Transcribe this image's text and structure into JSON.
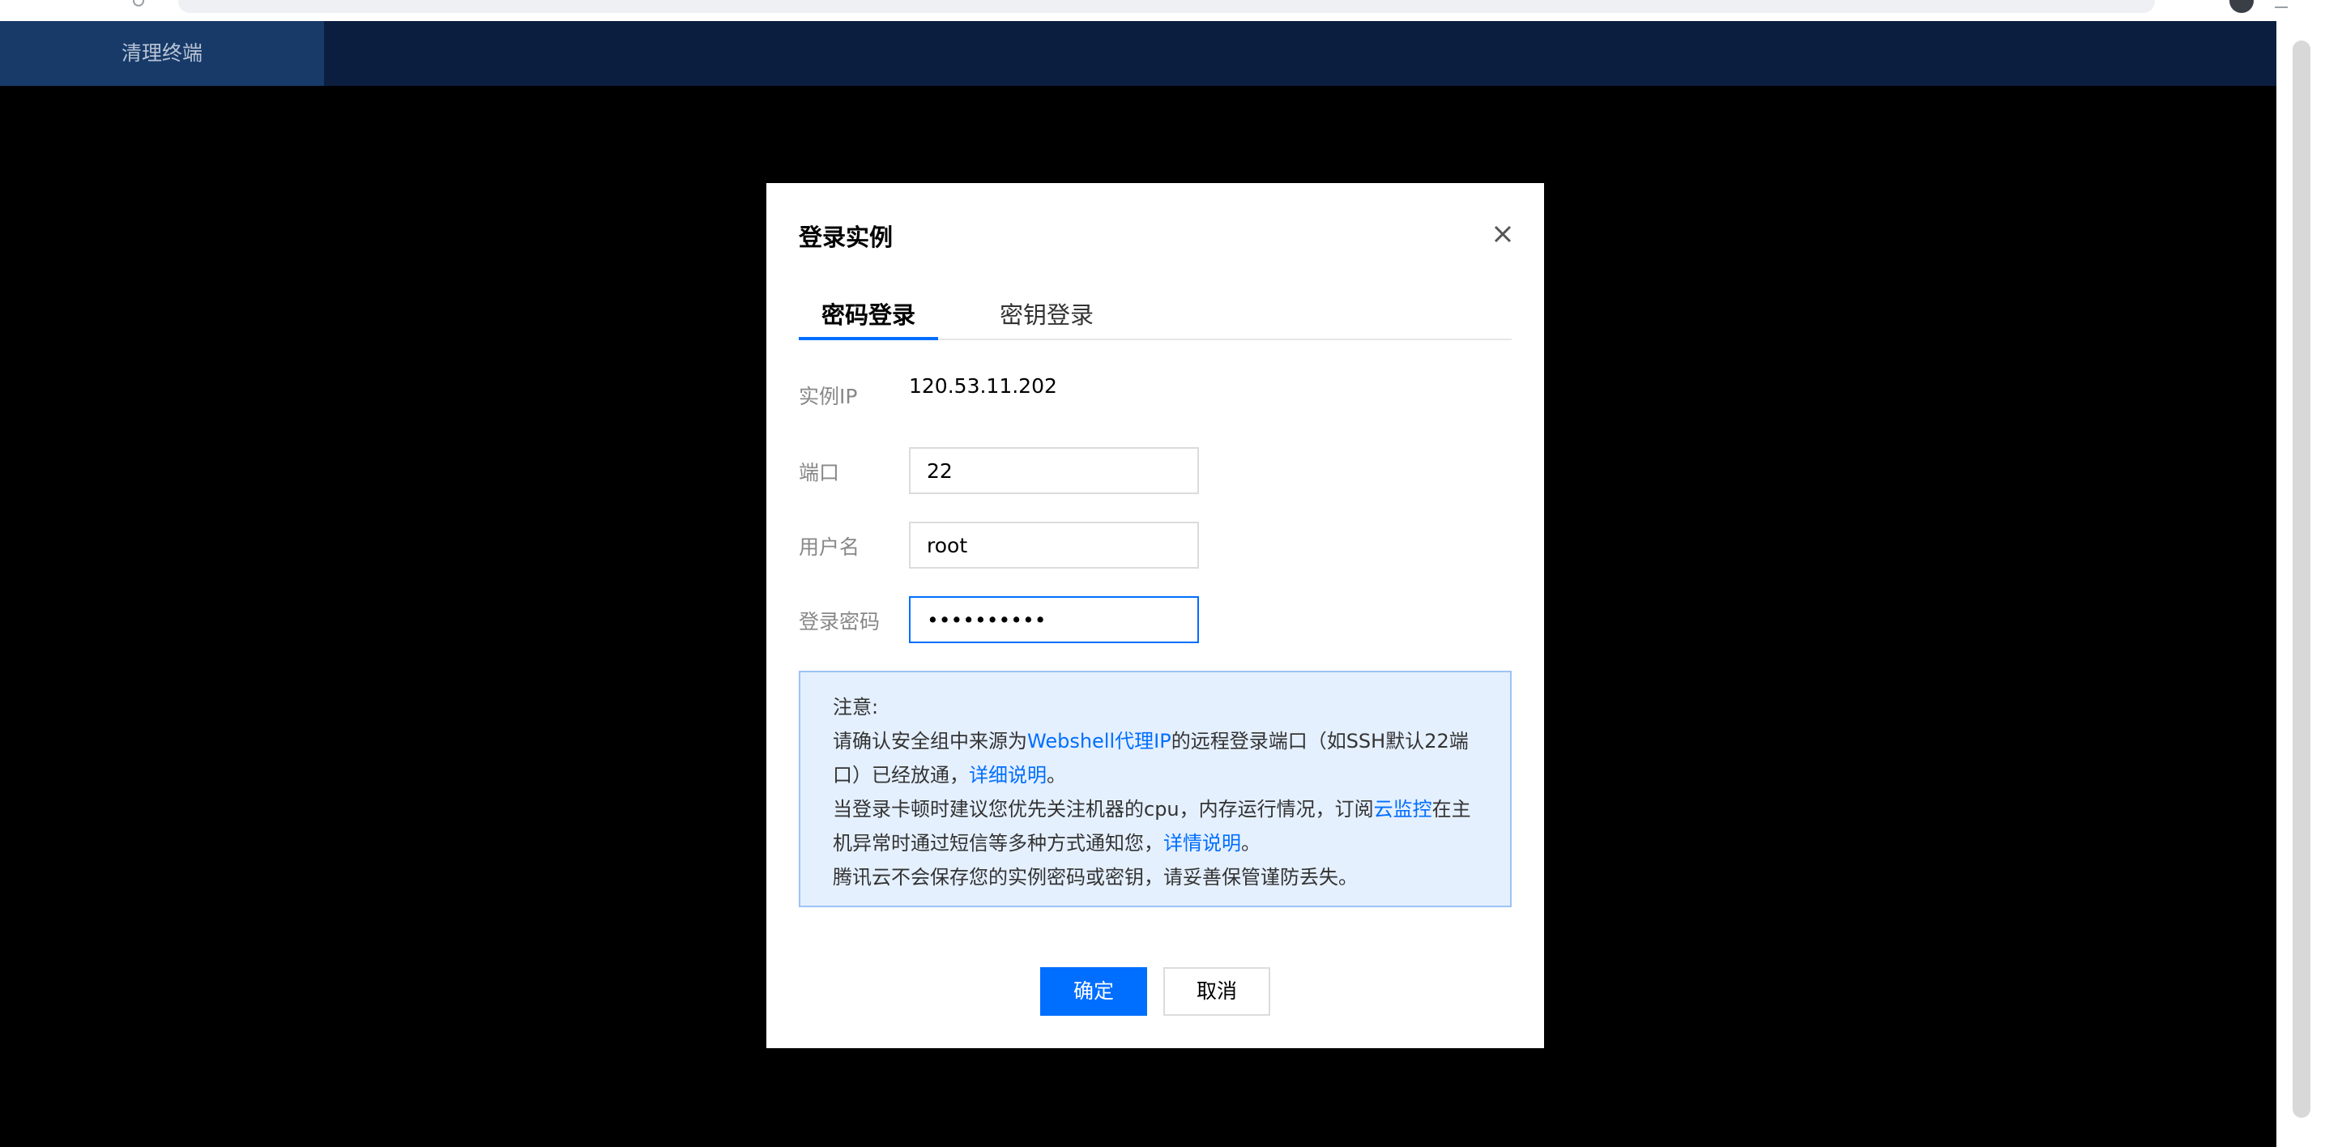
{
  "app": {
    "clear_terminal_label": "清理终端"
  },
  "dialog": {
    "title": "登录实例",
    "tabs": [
      {
        "label": "密码登录",
        "active": true
      },
      {
        "label": "密钥登录",
        "active": false
      }
    ],
    "fields": {
      "instance_ip": {
        "label": "实例IP",
        "value": "120.53.11.202"
      },
      "port": {
        "label": "端口",
        "value": "22"
      },
      "username": {
        "label": "用户名",
        "value": "root"
      },
      "password": {
        "label": "登录密码",
        "value": "••••••••••"
      }
    },
    "notice": {
      "heading": "注意:",
      "line1_prefix": "请确认安全组中来源为",
      "line1_link": "Webshell代理IP",
      "line1_middle": "的远程登录端口（如SSH默认22端口）已经放通，",
      "line1_link2": "详细说明",
      "line1_suffix": "。",
      "line2_prefix": "当登录卡顿时建议您优先关注机器的cpu，内存运行情况，订阅",
      "line2_link": "云监控",
      "line2_middle": "在主机异常时通过短信等多种方式通知您，",
      "line2_link2": "详情说明",
      "line2_suffix": "。",
      "line3": "腾讯云不会保存您的实例密码或密钥，请妥善保管谨防丢失。"
    },
    "buttons": {
      "ok_label": "确定",
      "cancel_label": "取消"
    }
  },
  "colors": {
    "accent": "#006eff",
    "header_bg": "#0b1e3f",
    "notice_bg": "#e5f0ff"
  },
  "icons": {
    "close": "close-icon"
  }
}
